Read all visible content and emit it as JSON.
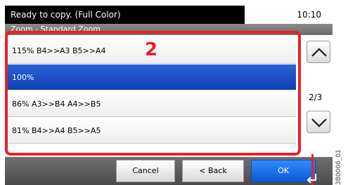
{
  "status": {
    "message": "Ready to copy. (Full Color)",
    "time": "10:10"
  },
  "subheader": {
    "title": "Zoom - Standard Zoom"
  },
  "list": {
    "items": [
      {
        "label": "115% B4>>A3 B5>>A4",
        "selected": false
      },
      {
        "label": "100%",
        "selected": true
      },
      {
        "label": "86% A3>>B4 A4>>B5",
        "selected": false
      },
      {
        "label": "81% B4>>A4 B5>>A5",
        "selected": false
      }
    ]
  },
  "pager": {
    "page_indicator": "2/3",
    "up_icon": "chevron-up-icon",
    "down_icon": "chevron-down-icon"
  },
  "buttons": {
    "cancel_label": "Cancel",
    "back_label": "< Back",
    "ok_label": "OK"
  },
  "annotation": {
    "callout_number": "2",
    "figure_id": "3B0006_01"
  },
  "colors": {
    "highlight": "#e8202a",
    "selection": "#1f55cc",
    "ok_button": "#1a6ff0"
  }
}
